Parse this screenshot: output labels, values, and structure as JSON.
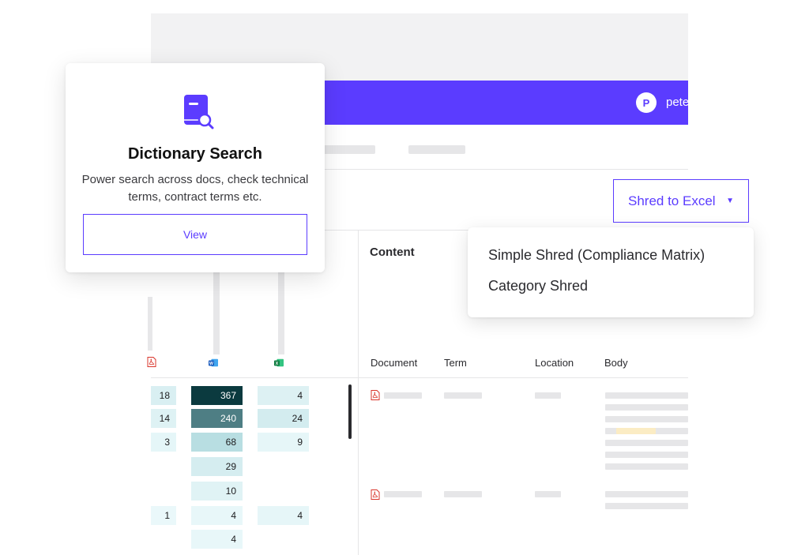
{
  "header": {
    "avatar_initial": "P",
    "username": "pete"
  },
  "card": {
    "title": "Dictionary Search",
    "description": "Power search across docs, check technical terms, contract terms etc.",
    "view_label": "View"
  },
  "toolbar": {
    "shred_label": "Shred to Excel",
    "shred_caret": "▼"
  },
  "dropdown": {
    "items": [
      "Simple Shred (Compliance Matrix)",
      "Category Shred"
    ]
  },
  "content": {
    "heading": "Content",
    "columns": [
      "Document",
      "Term",
      "Location",
      "Body"
    ]
  },
  "counts": {
    "pdf": [
      "18",
      "14",
      "3",
      "",
      "",
      "1",
      ""
    ],
    "word": [
      "367",
      "240",
      "68",
      "29",
      "10",
      "4",
      "4"
    ],
    "excel": [
      "4",
      "24",
      "9",
      "",
      "",
      "4",
      ""
    ]
  },
  "colors": {
    "accent": "#5b3cff",
    "pdf": "#d9342b",
    "word": "#185abd",
    "excel": "#107c41"
  }
}
